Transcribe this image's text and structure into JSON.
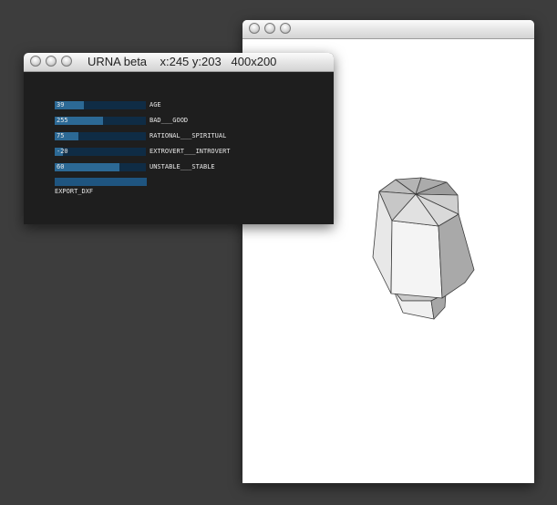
{
  "viewer_window": {
    "title": ""
  },
  "controls_window": {
    "title": "URNA beta    x:245 y:203   400x200"
  },
  "sliders": [
    {
      "value": "39",
      "label": "AGE",
      "fraction": 0.32
    },
    {
      "value": "255",
      "label": "BAD___GOOD",
      "fraction": 0.53
    },
    {
      "value": "75",
      "label": "RATIONAL___SPIRITUAL",
      "fraction": 0.26
    },
    {
      "value": "-20",
      "label": "EXTROVERT___INTROVERT",
      "fraction": 0.09
    },
    {
      "value": "60",
      "label": "UNSTABLE___STABLE",
      "fraction": 0.71
    }
  ],
  "export": {
    "label": "EXPORT_DXF"
  },
  "colors": {
    "desktop": "#3d3d3d",
    "panel_bg": "#1e1e1e",
    "slider_track": "#0f2c45",
    "slider_fill": "#2c6995",
    "urn_light": "#f2f2f2",
    "urn_mid": "#cfcfcf",
    "urn_dark": "#9d9d9d"
  }
}
